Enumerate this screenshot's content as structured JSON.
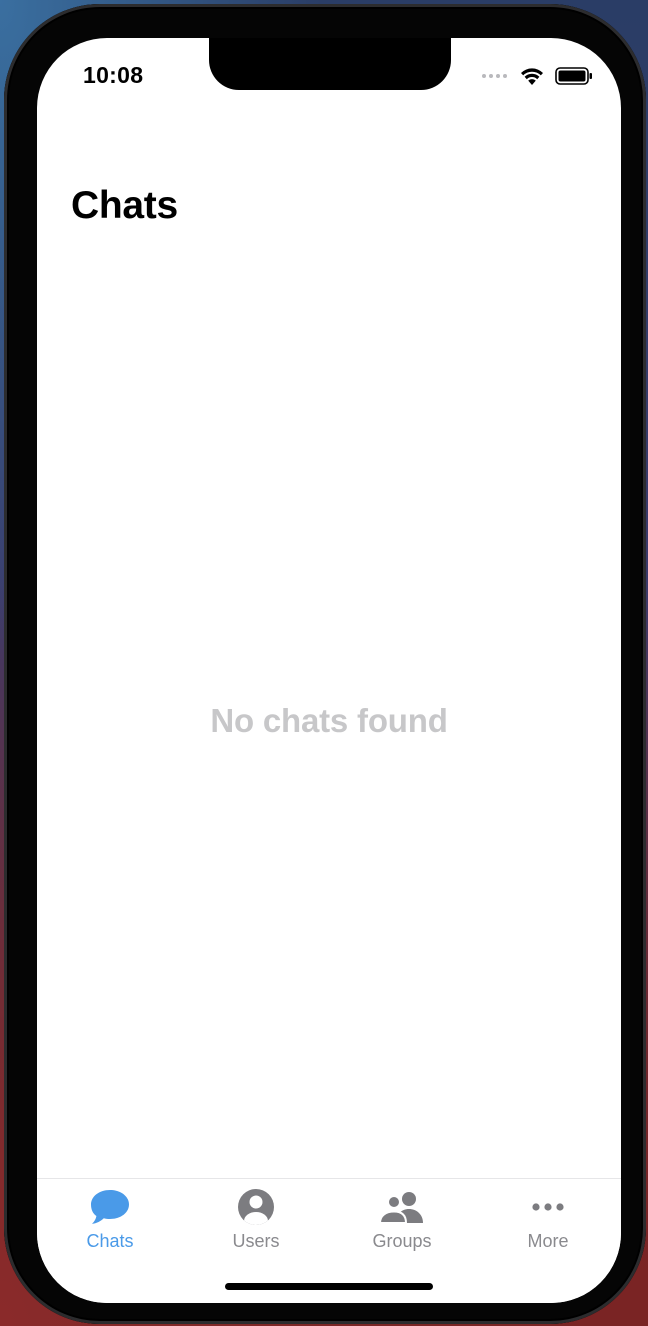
{
  "status_bar": {
    "time": "10:08",
    "icons": [
      "signal-dots-icon",
      "wifi-icon",
      "battery-icon"
    ]
  },
  "header": {
    "title": "Chats"
  },
  "main": {
    "empty_message": "No chats found"
  },
  "tab_bar": {
    "items": [
      {
        "label": "Chats",
        "icon": "chat-bubble-icon",
        "active": true
      },
      {
        "label": "Users",
        "icon": "user-circle-icon",
        "active": false
      },
      {
        "label": "Groups",
        "icon": "group-icon",
        "active": false
      },
      {
        "label": "More",
        "icon": "more-dots-icon",
        "active": false
      }
    ]
  },
  "colors": {
    "accent": "#4a9ae8",
    "inactive": "#8a8a8e",
    "empty_text": "#c7c7c9",
    "background": "#ffffff"
  }
}
